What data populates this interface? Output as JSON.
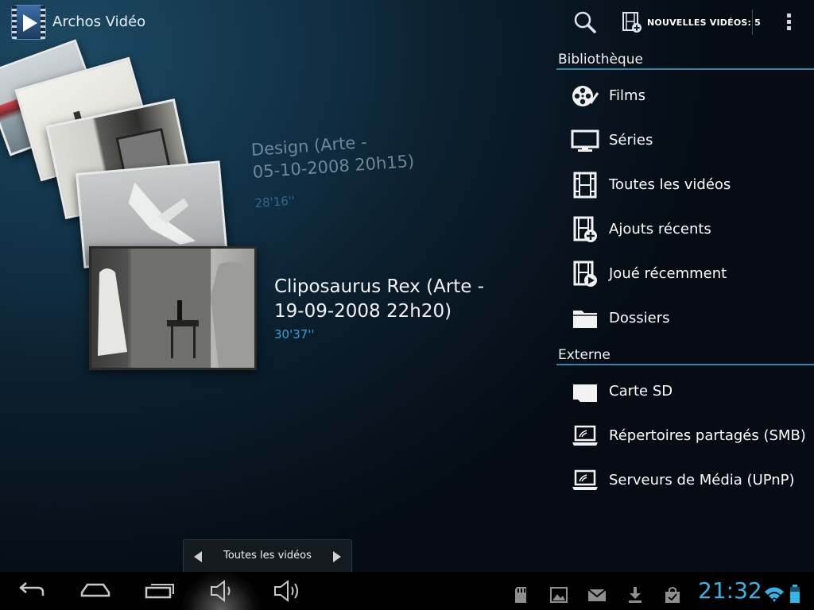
{
  "app": {
    "title": "Archos Vidéo"
  },
  "actionbar": {
    "new_videos_label": "NOUVELLES VIDÉOS: 5"
  },
  "carousel": {
    "secondary": {
      "title_line1": "Design (Arte -",
      "title_line2": "05-10-2008 20h15)",
      "duration": "28'16''"
    },
    "current": {
      "title_line1": "Cliposaurus Rex (Arte -",
      "title_line2": "19-09-2008 22h20)",
      "duration": "30'37''"
    }
  },
  "library": {
    "header": "Bibliothèque",
    "items": [
      {
        "label": "Films",
        "icon": "film-reel-icon"
      },
      {
        "label": "Séries",
        "icon": "tv-monitor-icon"
      },
      {
        "label": "Toutes les vidéos",
        "icon": "film-strip-icon"
      },
      {
        "label": "Ajouts récents",
        "icon": "film-add-icon"
      },
      {
        "label": "Joué récemment",
        "icon": "film-play-icon"
      },
      {
        "label": "Dossiers",
        "icon": "folder-icon"
      }
    ]
  },
  "external": {
    "header": "Externe",
    "items": [
      {
        "label": "Carte SD",
        "icon": "sd-card-icon"
      },
      {
        "label": "Répertoires partagés (SMB)",
        "icon": "network-laptop-icon"
      },
      {
        "label": "Serveurs de Média (UPnP)",
        "icon": "network-laptop-icon"
      }
    ]
  },
  "pager": {
    "label": "Toutes les vidéos"
  },
  "systembar": {
    "time": "21:32",
    "accent": "#33b5e5"
  }
}
